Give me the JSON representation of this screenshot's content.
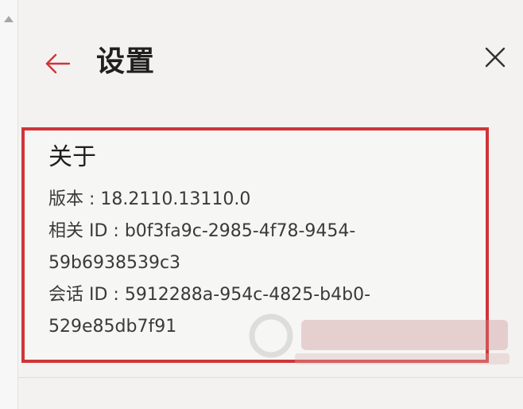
{
  "header": {
    "title": "设置"
  },
  "icons": {
    "back": "arrow-left-icon",
    "close": "close-icon",
    "scroll_up": "triangle-up-icon"
  },
  "about": {
    "title": "关于",
    "version_line": "版本 : 18.2110.13110.0",
    "correlation_line1": "相关 ID : b0f3fa9c-2985-4f78-9454-",
    "correlation_line2": "59b6938539c3",
    "session_line1": "会话 ID : 5912288a-954c-4825-b4b0-",
    "session_line2": "529e85db7f91"
  },
  "colors": {
    "highlight_border": "#d13438",
    "back_arrow": "#d13438",
    "panel_bg": "#f3f2f1",
    "text": "#3b3a39"
  }
}
